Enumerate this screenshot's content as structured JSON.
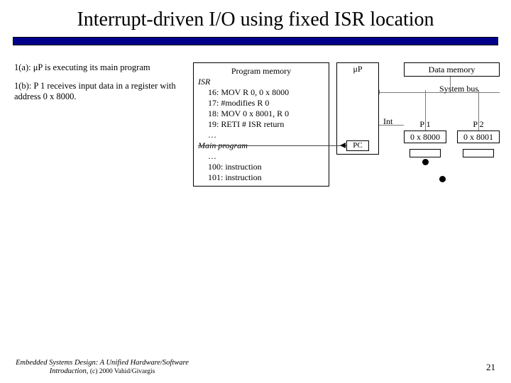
{
  "title": "Interrupt-driven I/O using fixed ISR location",
  "left": {
    "p1": "1(a): μP is executing its main program",
    "p2": "1(b): P 1 receives input data in a register with address 0 x 8000."
  },
  "mem": {
    "header": "Program memory",
    "isr": "ISR",
    "l16": "16:  MOV R 0, 0 x 8000",
    "l17": "17:  #modifies R 0",
    "l18": "18:  MOV 0 x 8001, R 0",
    "l19": "19:  RETI  # ISR return",
    "dots1": "…",
    "main": "Main program",
    "dots2": "…",
    "l100": "100: instruction",
    "l101": "101: instruction"
  },
  "diag": {
    "up": "μP",
    "dm": "Data memory",
    "bus": "System bus",
    "int": "Int",
    "pc": "PC",
    "p1": "P 1",
    "p2": "P 2",
    "addr1": "0 x 8000",
    "addr2": "0 x 8001"
  },
  "footer": {
    "book": "Embedded Systems Design: A Unified Hardware/Software Introduction,",
    "copy": " (c) 2000 Vahid/Givargis"
  },
  "page": "21"
}
